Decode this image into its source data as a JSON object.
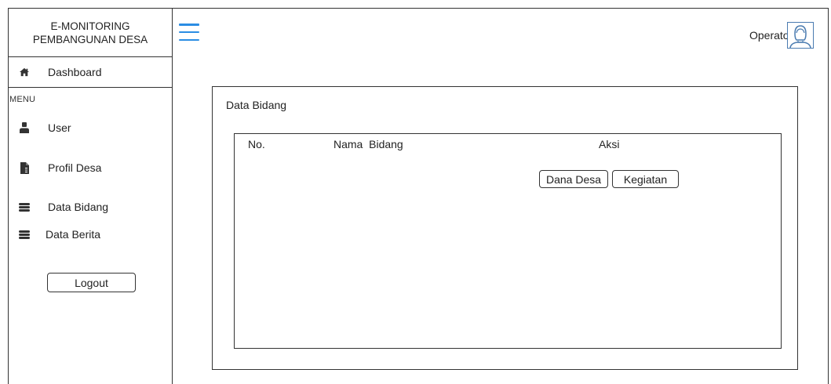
{
  "app": {
    "title_line1": "E-MONITORING",
    "title_line2": "PEMBANGUNAN DESA"
  },
  "header": {
    "menu_icon": "hamburger-icon",
    "user_role": "Operator",
    "avatar_icon": "user-avatar-icon",
    "accent_color": "#2b8de3"
  },
  "sidebar": {
    "dashboard": {
      "label": "Dashboard",
      "icon": "home-icon"
    },
    "menu_heading": "MENU",
    "items": [
      {
        "label": "User",
        "icon": "user-icon"
      },
      {
        "label": "Profil Desa",
        "icon": "document-icon"
      },
      {
        "label": "Data Bidang",
        "icon": "database-icon"
      },
      {
        "label": "Data Berita",
        "icon": "database-icon"
      }
    ],
    "logout_label": "Logout"
  },
  "main": {
    "title": "Data Bidang",
    "table": {
      "columns": [
        "No.",
        "Nama  Bidang",
        "Aksi"
      ],
      "actions": [
        "Dana Desa",
        "Kegiatan"
      ]
    }
  }
}
